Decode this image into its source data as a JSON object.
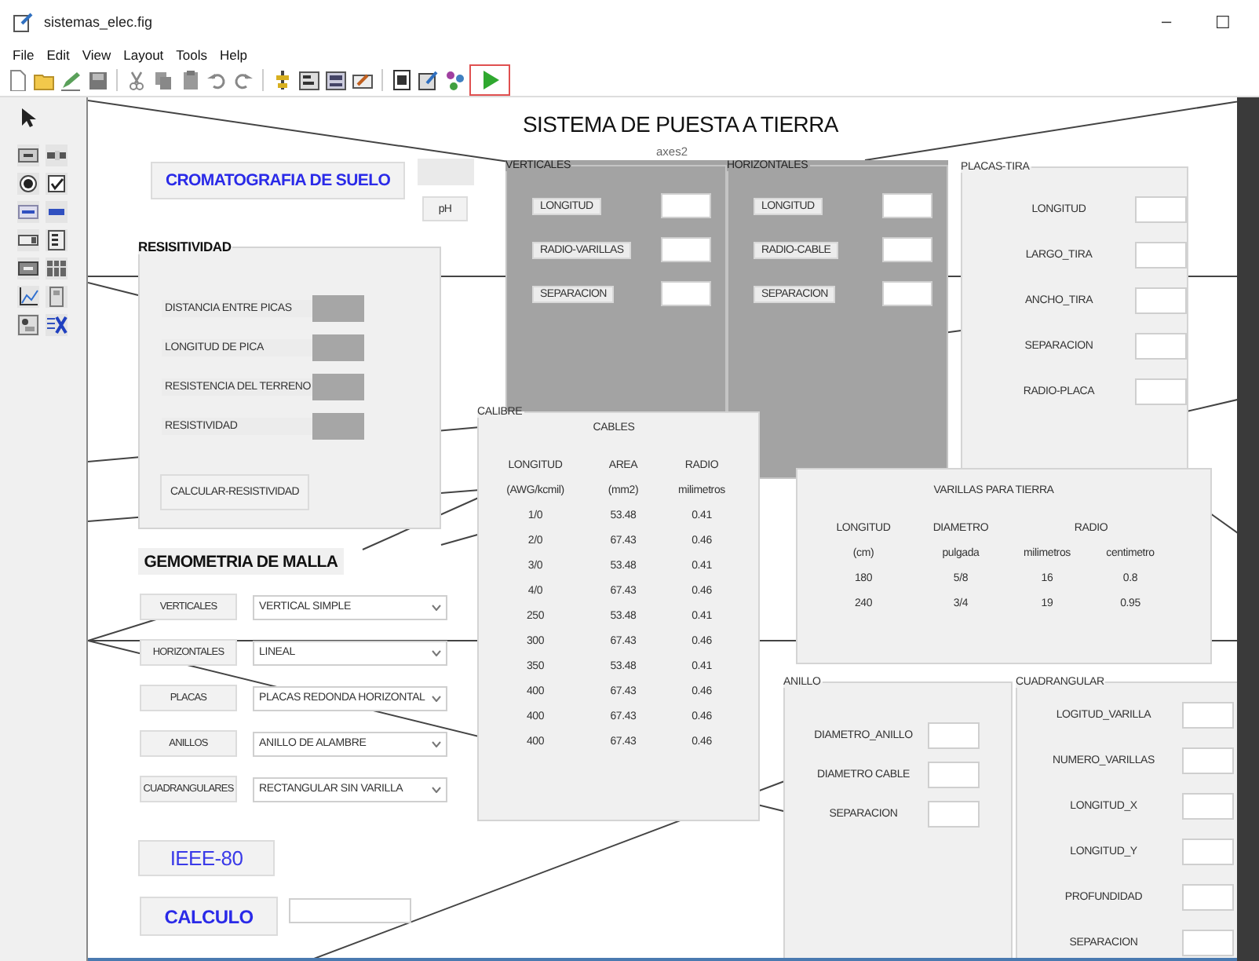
{
  "window": {
    "title": "sistemas_elec.fig",
    "controls": [
      "–",
      "☐"
    ]
  },
  "menu": [
    "File",
    "Edit",
    "View",
    "Layout",
    "Tools",
    "Help"
  ],
  "toolbar": {
    "run_highlighted": true
  },
  "canvas": {
    "title": "SISTEMA DE PUESTA A TIERRA",
    "axes_label": "axes2",
    "soil_button": "CROMATOGRAFIA DE SUELO",
    "ph_button": "pH",
    "resistividad": {
      "title": "RESISITIVIDAD",
      "fields": [
        "DISTANCIA ENTRE PICAS",
        "LONGITUD DE PICA",
        "RESISTENCIA DEL TERRENO",
        "RESISTIVIDAD"
      ],
      "button": "CALCULAR-RESISTIVIDAD"
    },
    "verticales": {
      "title": "VERTICALES",
      "fields": [
        "LONGITUD",
        "RADIO-VARILLAS",
        "SEPARACION"
      ]
    },
    "horizontales": {
      "title": "HORIZONTALES",
      "fields": [
        "LONGITUD",
        "RADIO-CABLE",
        "SEPARACION"
      ]
    },
    "placas_tira": {
      "title": "PLACAS-TIRA",
      "fields": [
        "LONGITUD",
        "LARGO_TIRA",
        "ANCHO_TIRA",
        "SEPARACION",
        "RADIO-PLACA"
      ]
    },
    "calibre": {
      "title": "CALIBRE",
      "heading": "CABLES",
      "columns": [
        "LONGITUD",
        "AREA",
        "RADIO"
      ],
      "units": [
        "(AWG/kcmil)",
        "(mm2)",
        "milimetros"
      ],
      "rows": [
        [
          "1/0",
          "53.48",
          "0.41"
        ],
        [
          "2/0",
          "67.43",
          "0.46"
        ],
        [
          "3/0",
          "53.48",
          "0.41"
        ],
        [
          "4/0",
          "67.43",
          "0.46"
        ],
        [
          "250",
          "53.48",
          "0.41"
        ],
        [
          "300",
          "67.43",
          "0.46"
        ],
        [
          "350",
          "53.48",
          "0.41"
        ],
        [
          "400",
          "67.43",
          "0.46"
        ],
        [
          "400",
          "67.43",
          "0.46"
        ],
        [
          "400",
          "67.43",
          "0.46"
        ]
      ]
    },
    "varillas": {
      "title": "VARILLAS PARA TIERRA",
      "columns": [
        "LONGITUD",
        "DIAMETRO",
        "RADIO"
      ],
      "units": [
        "(cm)",
        "pulgada",
        "milimetros",
        "centimetro"
      ],
      "rows": [
        [
          "180",
          "5/8",
          "16",
          "0.8"
        ],
        [
          "240",
          "3/4",
          "19",
          "0.95"
        ]
      ]
    },
    "geometria": {
      "title": "GEMOMETRIA DE MALLA",
      "rows": [
        {
          "button": "VERTICALES",
          "value": "VERTICAL SIMPLE"
        },
        {
          "button": "HORIZONTALES",
          "value": "LINEAL"
        },
        {
          "button": "PLACAS",
          "value": "PLACAS REDONDA HORIZONTAL"
        },
        {
          "button": "ANILLOS",
          "value": "ANILLO DE ALAMBRE"
        },
        {
          "button": "CUADRANGULARES",
          "value": "RECTANGULAR SIN VARILLA"
        }
      ]
    },
    "anillo": {
      "title": "ANILLO",
      "fields": [
        "DIAMETRO_ANILLO",
        "DIAMETRO CABLE",
        "SEPARACION"
      ]
    },
    "cuadrangular": {
      "title": "CUADRANGULAR",
      "fields": [
        "LOGITUD_VARILLA",
        "NUMERO_VARILLAS",
        "LONGITUD_X",
        "LONGITUD_Y",
        "PROFUNDIDAD",
        "SEPARACION"
      ]
    },
    "ieee_button": "IEEE-80",
    "calc_button": "CALCULO"
  }
}
